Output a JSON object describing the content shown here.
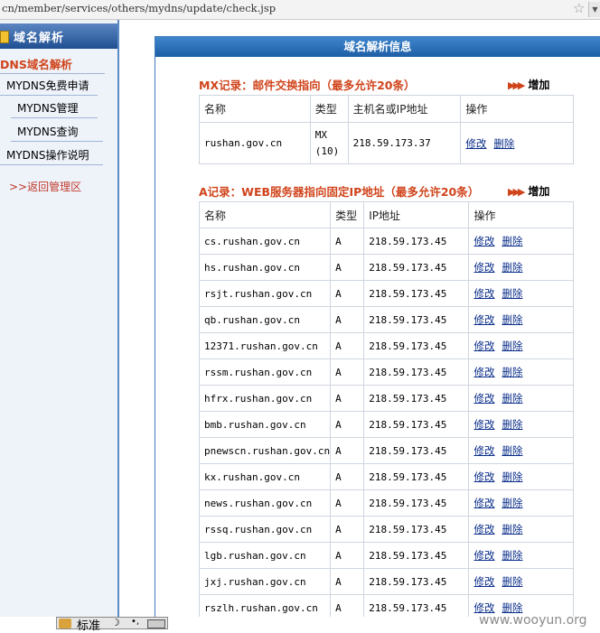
{
  "address_bar": {
    "url": "cn/member/services/others/mydns/update/check.jsp"
  },
  "sidebar": {
    "header": "域名解析",
    "section_title": "DNS域名解析",
    "items": [
      {
        "label": "MYDNS免费申请"
      },
      {
        "label": "MYDNS管理"
      },
      {
        "label": "MYDNS查询"
      },
      {
        "label": "MYDNS操作说明"
      }
    ],
    "back_link": ">>返回管理区"
  },
  "main": {
    "title": "域名解析信息",
    "add_label": "增加",
    "mx": {
      "title": "MX记录：邮件交换指向（最多允许20条）",
      "headers": [
        "名称",
        "类型",
        "主机名或IP地址",
        "操作"
      ],
      "rows": [
        {
          "name": "rushan.gov.cn",
          "type": "MX",
          "priority": "(10)",
          "ip": "218.59.173.37"
        }
      ]
    },
    "a": {
      "title": "A记录：WEB服务器指向固定IP地址（最多允许20条）",
      "headers": [
        "名称",
        "类型",
        "IP地址",
        "操作"
      ],
      "rows": [
        {
          "name": "cs.rushan.gov.cn",
          "type": "A",
          "ip": "218.59.173.45"
        },
        {
          "name": "hs.rushan.gov.cn",
          "type": "A",
          "ip": "218.59.173.45"
        },
        {
          "name": "rsjt.rushan.gov.cn",
          "type": "A",
          "ip": "218.59.173.45"
        },
        {
          "name": "qb.rushan.gov.cn",
          "type": "A",
          "ip": "218.59.173.45"
        },
        {
          "name": "12371.rushan.gov.cn",
          "type": "A",
          "ip": "218.59.173.45"
        },
        {
          "name": "rssm.rushan.gov.cn",
          "type": "A",
          "ip": "218.59.173.45"
        },
        {
          "name": "hfrx.rushan.gov.cn",
          "type": "A",
          "ip": "218.59.173.45"
        },
        {
          "name": "bmb.rushan.gov.cn",
          "type": "A",
          "ip": "218.59.173.45"
        },
        {
          "name": "pnewscn.rushan.gov.cn",
          "type": "A",
          "ip": "218.59.173.45"
        },
        {
          "name": "kx.rushan.gov.cn",
          "type": "A",
          "ip": "218.59.173.45"
        },
        {
          "name": "news.rushan.gov.cn",
          "type": "A",
          "ip": "218.59.173.45"
        },
        {
          "name": "rssq.rushan.gov.cn",
          "type": "A",
          "ip": "218.59.173.45"
        },
        {
          "name": "lgb.rushan.gov.cn",
          "type": "A",
          "ip": "218.59.173.45"
        },
        {
          "name": "jxj.rushan.gov.cn",
          "type": "A",
          "ip": "218.59.173.45"
        },
        {
          "name": "rszlh.rushan.gov.cn",
          "type": "A",
          "ip": "218.59.173.45"
        }
      ]
    },
    "actions": {
      "edit": "修改",
      "delete": "删除"
    }
  },
  "taskbar": {
    "ime_mode": "标准"
  },
  "watermark": "www.wooyun.org"
}
